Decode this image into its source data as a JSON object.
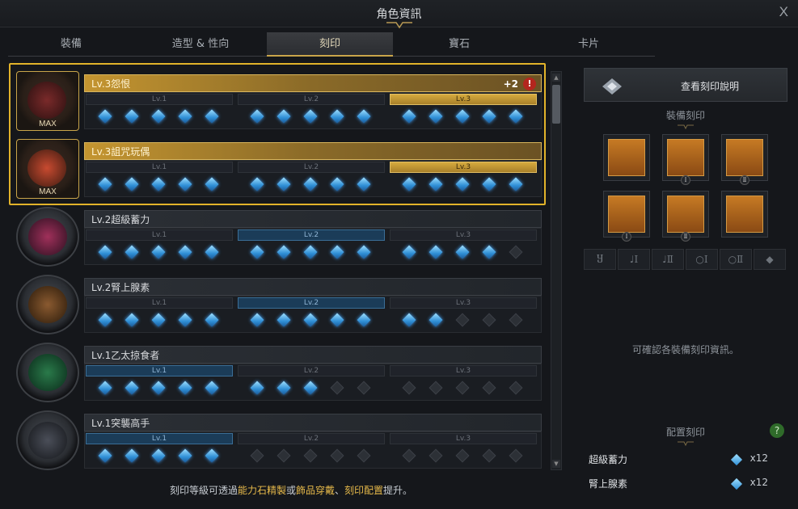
{
  "window": {
    "title": "角色資訊",
    "close": "X"
  },
  "tabs": [
    {
      "label": "裝備"
    },
    {
      "label": "造型 & 性向"
    },
    {
      "label": "刻印"
    },
    {
      "label": "寶石"
    },
    {
      "label": "卡片"
    }
  ],
  "active_tab": "刻印",
  "engravings": [
    {
      "name": "Lv.3怨恨",
      "badge": "MAX",
      "plus": "+2",
      "warn": "!",
      "level": 3,
      "gems": [
        5,
        5,
        5
      ],
      "highlight": true
    },
    {
      "name": "Lv.3詛咒玩偶",
      "badge": "MAX",
      "level": 3,
      "gems": [
        5,
        5,
        5
      ],
      "highlight": true
    },
    {
      "name": "Lv.2超級蓄力",
      "level": 2,
      "gems": [
        5,
        5,
        4
      ],
      "highlight": false
    },
    {
      "name": "Lv.2腎上腺素",
      "level": 2,
      "gems": [
        5,
        5,
        2
      ],
      "highlight": false
    },
    {
      "name": "Lv.1乙太掠食者",
      "level": 1,
      "gems": [
        5,
        3,
        0
      ],
      "highlight": false
    },
    {
      "name": "Lv.1突襲高手",
      "level": 1,
      "gems": [
        5,
        0,
        0
      ],
      "highlight": false
    }
  ],
  "level_labels": [
    "Lv.1",
    "Lv.2",
    "Lv.3"
  ],
  "footer": {
    "pre": "刻印等級可透過",
    "a": "能力石精製",
    "mid": "或",
    "b": "飾品穿戴",
    "sep": "、",
    "c": "刻印配置",
    "post": "提升。"
  },
  "right": {
    "view_button": "查看刻印說明",
    "equip_header": "裝備刻印",
    "slot_numerals": [
      "Ⅰ",
      "Ⅱ",
      "Ⅰ",
      "Ⅱ"
    ],
    "filter_numerals": [
      "Ⅰ",
      "Ⅱ",
      "Ⅰ",
      "Ⅱ"
    ],
    "info": "可確認各裝備刻印資訊。",
    "config_header": "配置刻印",
    "help": "?",
    "config": [
      {
        "name": "超級蓄力",
        "count": "x12"
      },
      {
        "name": "腎上腺素",
        "count": "x12"
      }
    ]
  }
}
